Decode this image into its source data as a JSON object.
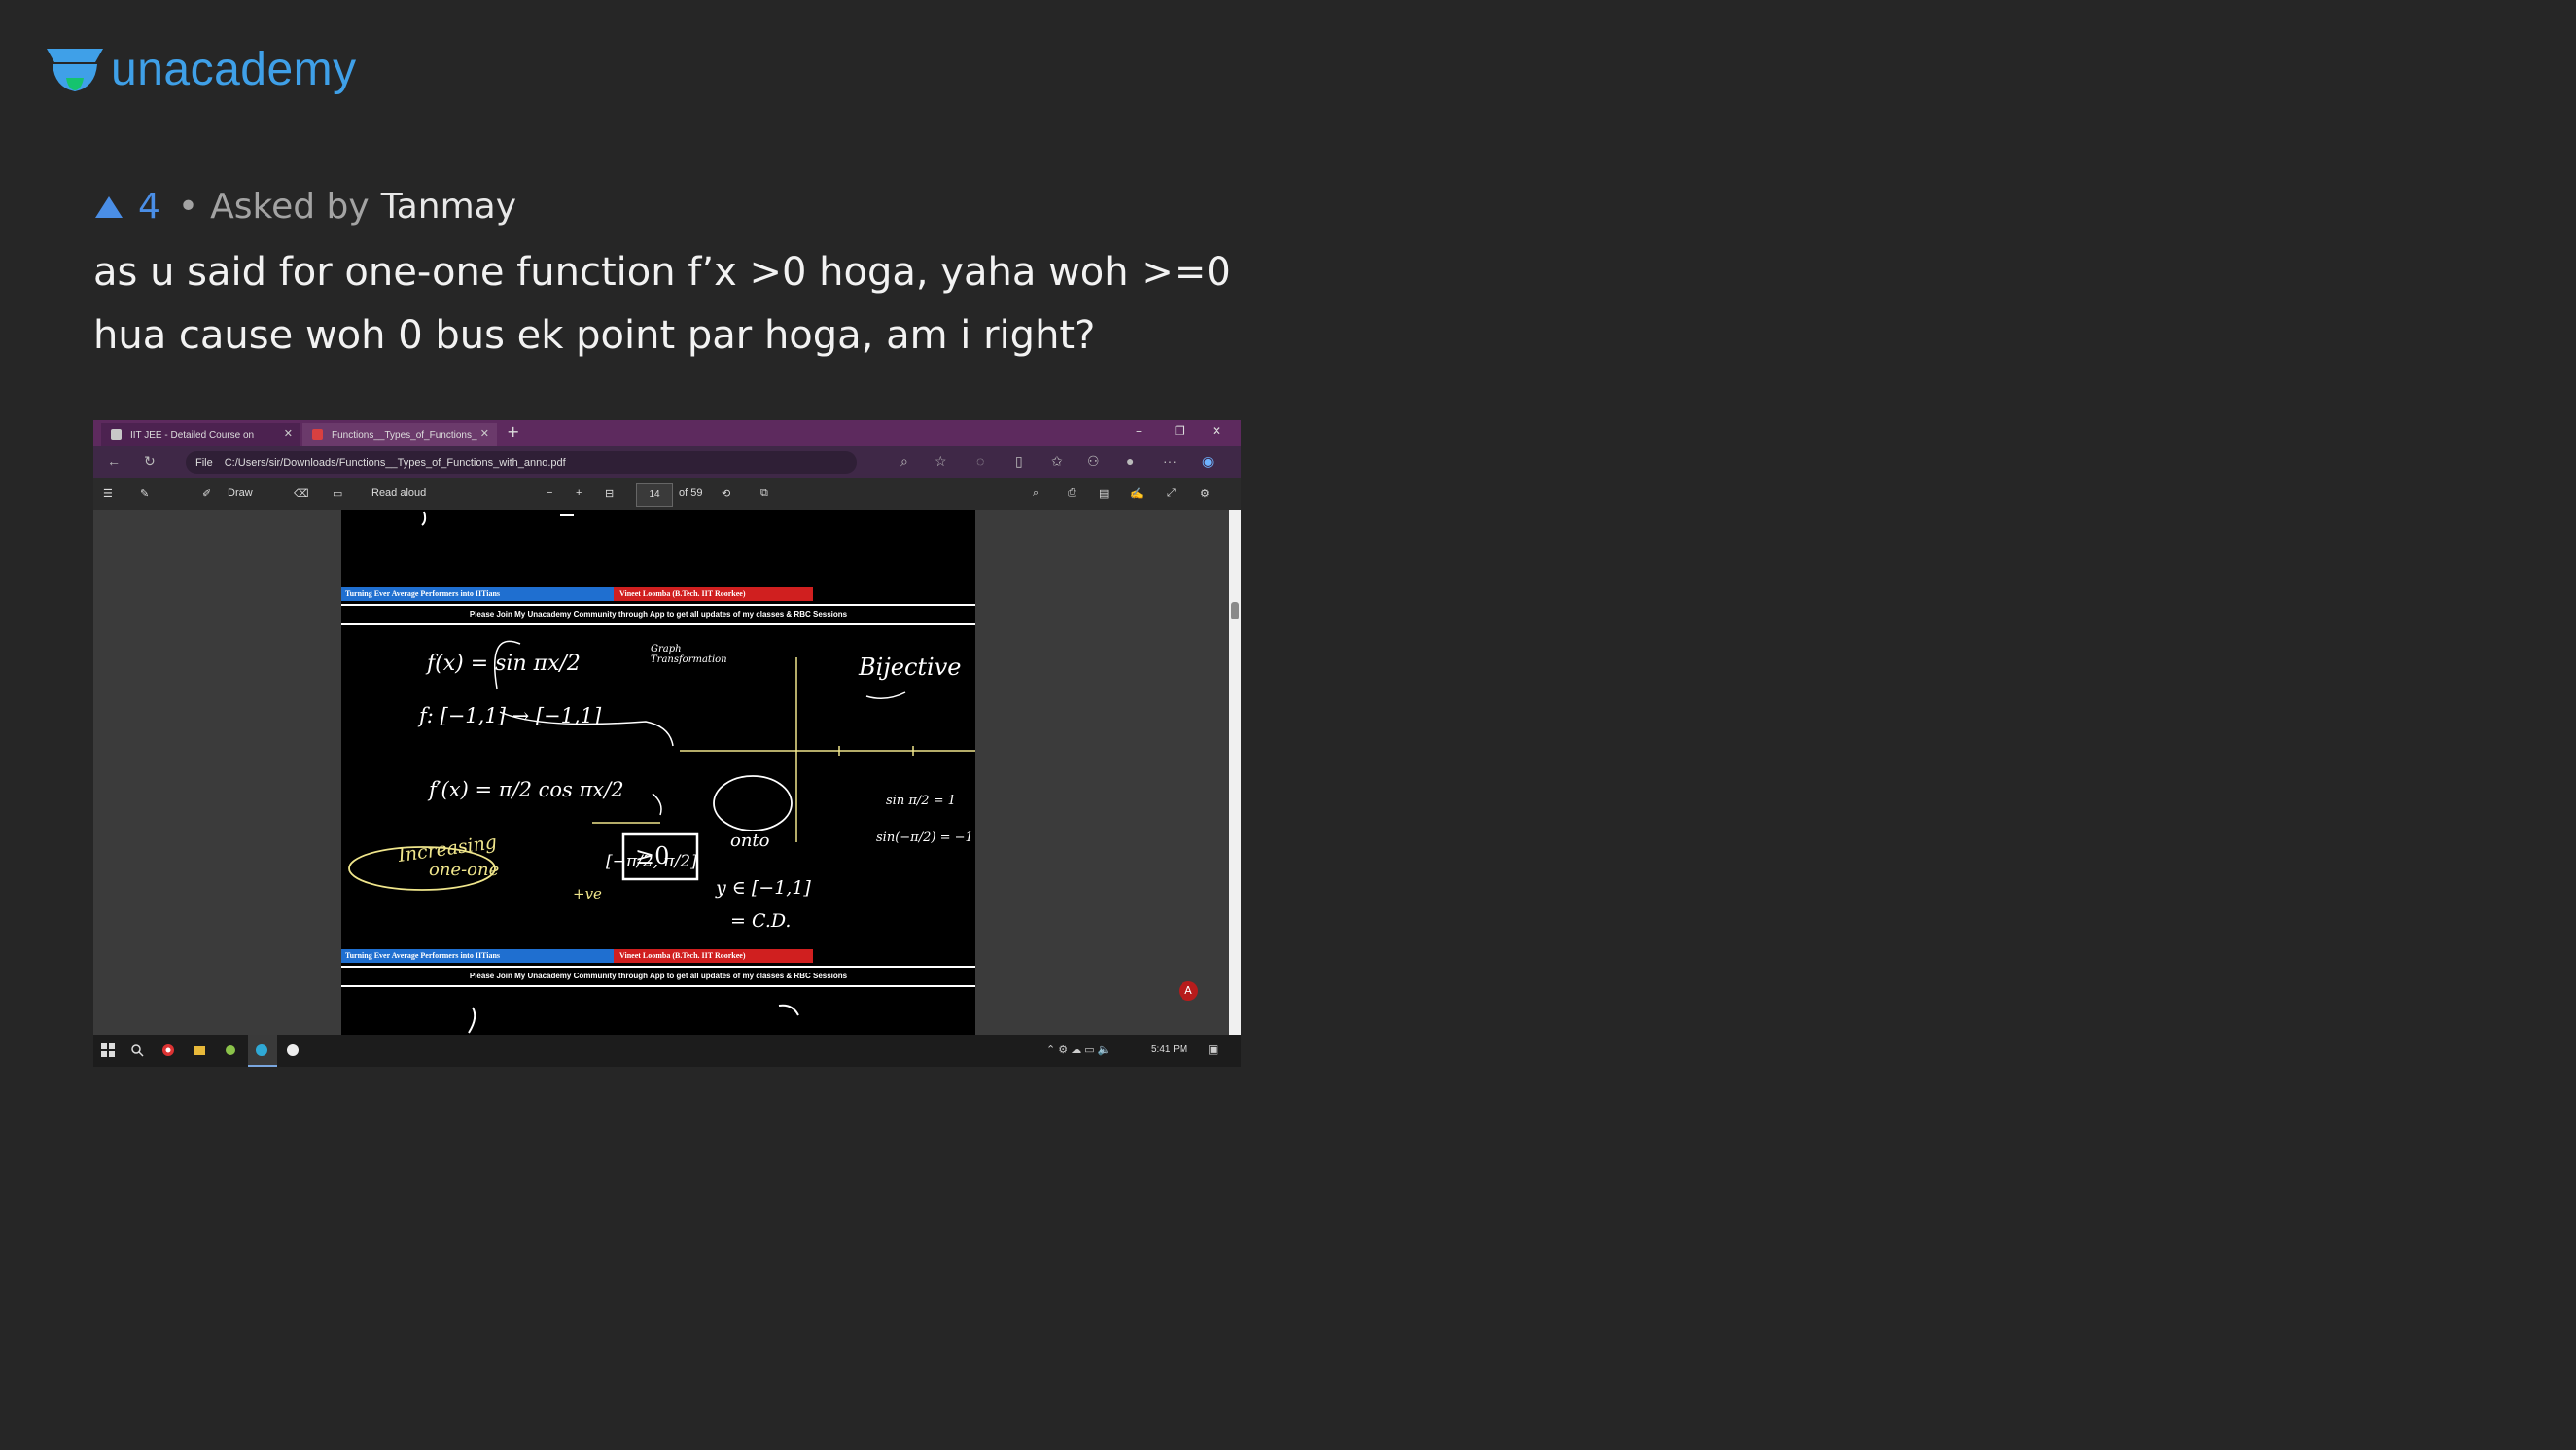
{
  "brand": {
    "name": "unacademy",
    "color": "#3fa0e8",
    "logo_icon": "unacademy-logo-icon"
  },
  "question": {
    "upvote_icon": "upvote-triangle-icon",
    "votes": "4",
    "separator": "•",
    "asked_by_label": "Asked by",
    "author": "Tanmay",
    "text": "as u said for one-one function f’x >0 hoga, yaha woh >=0 hua cause woh 0 bus ek point par hoga, am i right?"
  },
  "screenshot": {
    "tabs": [
      {
        "label": "IIT JEE - Detailed Course on",
        "icon": "audio-tab-icon"
      },
      {
        "label": "Functions__Types_of_Functions_",
        "icon": "pdf-tab-icon"
      }
    ],
    "new_tab": "+",
    "address": {
      "file_label": "File",
      "url": "C:/Users/sir/Downloads/Functions__Types_of_Functions_with_anno.pdf"
    },
    "pdf_toolbar": {
      "draw_label": "Draw",
      "read_aloud_label": "Read aloud",
      "minus": "−",
      "plus": "+",
      "page_current": "14",
      "page_total": "of 59"
    },
    "page_banner": {
      "left": "Turning Ever Average Performers into IITians",
      "right": "Vineet Loomba (B.Tech. IIT Roorkee)"
    },
    "notice": "Please Join My Unacademy Community through App to get all updates of my classes & RBC Sessions",
    "handwriting": {
      "f_def": "f(x) = sin πx/2",
      "graph_note": "Graph Transformation",
      "bijective": "Bijective",
      "domain_map": "f: [−1,1] → [−1,1]",
      "derivative": "f′(x) = π/2 cos πx/2",
      "increasing": "Increasing",
      "one_one": "one-one",
      "interval": "[−π/2, π/2]",
      "onto": "onto",
      "sin1": "sin π/2 = 1",
      "sin2": "sin(−π/2) = −1",
      "positive": "+ve",
      "ge_zero": "≥0",
      "range": "y ∈ [−1,1]",
      "codomain": "= C.D."
    },
    "taskbar": {
      "time": "5:41 PM"
    }
  }
}
